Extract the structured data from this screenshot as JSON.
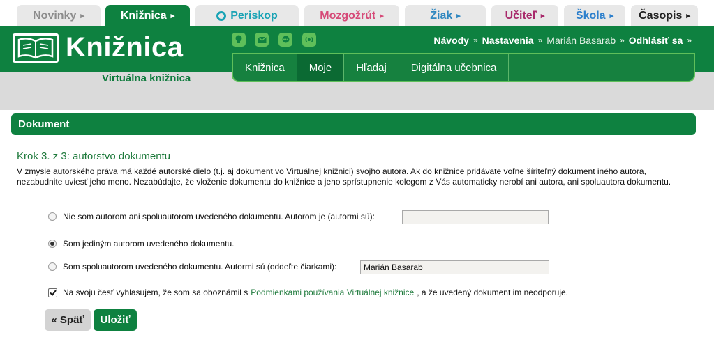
{
  "top_tabs": [
    {
      "label": "Novinky",
      "arrow": "▸"
    },
    {
      "label": "Knižnica",
      "arrow": "▸"
    },
    {
      "label": "Periskop",
      "arrow": ""
    },
    {
      "label": "Mozgožrút",
      "arrow": "▸"
    },
    {
      "label": "Žiak",
      "arrow": "▸"
    },
    {
      "label": "Učiteľ",
      "arrow": "▸"
    },
    {
      "label": "Škola",
      "arrow": "▸"
    },
    {
      "label": "Časopis",
      "arrow": "▸"
    }
  ],
  "header": {
    "title": "Knižnica",
    "subtitle": "Virtuálna knižnica",
    "links": {
      "navody": "Návody",
      "nastavenia": "Nastavenia",
      "user": "Marián Basarab",
      "logout": "Odhlásiť sa"
    },
    "separator": "»",
    "social_icons": [
      "lightbulb-icon",
      "mail-icon",
      "chat-icon",
      "broadcast-icon"
    ]
  },
  "nav": [
    "Knižnica",
    "Moje",
    "Hľadaj",
    "Digitálna učebnica"
  ],
  "section": {
    "title": "Dokument"
  },
  "step_title": "Krok 3. z 3: autorstvo dokumentu",
  "intro": "V zmysle autorského práva má každé autorské dielo (t.j. aj dokument vo Virtuálnej knižnici) svojho autora. Ak do knižnice pridávate voľne šíriteľný dokument iného autora, nezabudnite uviesť jeho meno. Nezabúdajte, že vloženie dokumentu do knižnice a jeho sprístupnenie kolegom z Vás automaticky nerobí ani autora, ani spoluautora dokumentu.",
  "options": {
    "not_author": {
      "label": "Nie som autorom ani spoluautorom uvedeného dokumentu. Autorom je (autormi sú):",
      "value": ""
    },
    "sole_author": {
      "label": "Som jediným autorom uvedeného dokumentu."
    },
    "coauthor": {
      "label": "Som spoluautorom uvedeného dokumentu. Autormi sú (oddeľte čiarkami):",
      "value": "Marián Basarab"
    }
  },
  "selected_option": "sole_author",
  "declaration": {
    "before": "Na svoju česť vyhlasujem, že som sa oboznámil s",
    "link": "Podmienkami používania Virtuálnej knižnice",
    "after": ", a že uvedený dokument im neodporuje.",
    "checked": true
  },
  "buttons": {
    "back": "« Späť",
    "save": "Uložiť"
  },
  "colors": {
    "brand_green": "#0e8140",
    "light_green": "#5fbf5a",
    "link_green": "#1e7a3c"
  }
}
